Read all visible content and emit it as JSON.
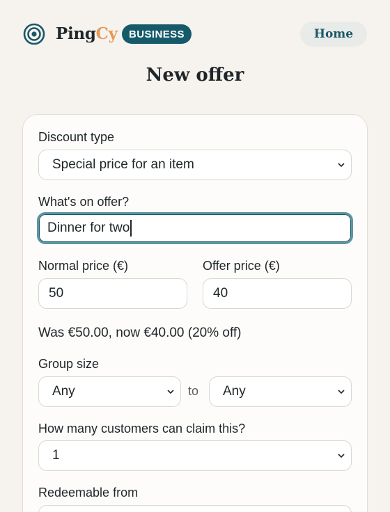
{
  "header": {
    "brand_main": "Ping",
    "brand_accent": "Cy",
    "badge": "BUSINESS",
    "home_label": "Home"
  },
  "page": {
    "title": "New offer"
  },
  "form": {
    "discount_type": {
      "label": "Discount type",
      "value": "Special price for an item"
    },
    "offer": {
      "label": "What's on offer?",
      "value": "Dinner for two"
    },
    "normal_price": {
      "label": "Normal price (€)",
      "value": "50"
    },
    "offer_price": {
      "label": "Offer price (€)",
      "value": "40"
    },
    "summary": "Was €50.00, now €40.00 (20% off)",
    "group_size": {
      "label": "Group size",
      "min": "Any",
      "separator": "to",
      "max": "Any"
    },
    "claims": {
      "label": "How many customers can claim this?",
      "value": "1"
    },
    "redeemable_from": {
      "label": "Redeemable from"
    }
  },
  "colors": {
    "brand_teal": "#155a6b",
    "accent_orange": "#e59a55",
    "background": "#f6f3ef",
    "focus_ring": "#5b95a2"
  },
  "icons": {
    "logo": "concentric-circles-icon",
    "select_arrow": "chevron-down-icon"
  }
}
